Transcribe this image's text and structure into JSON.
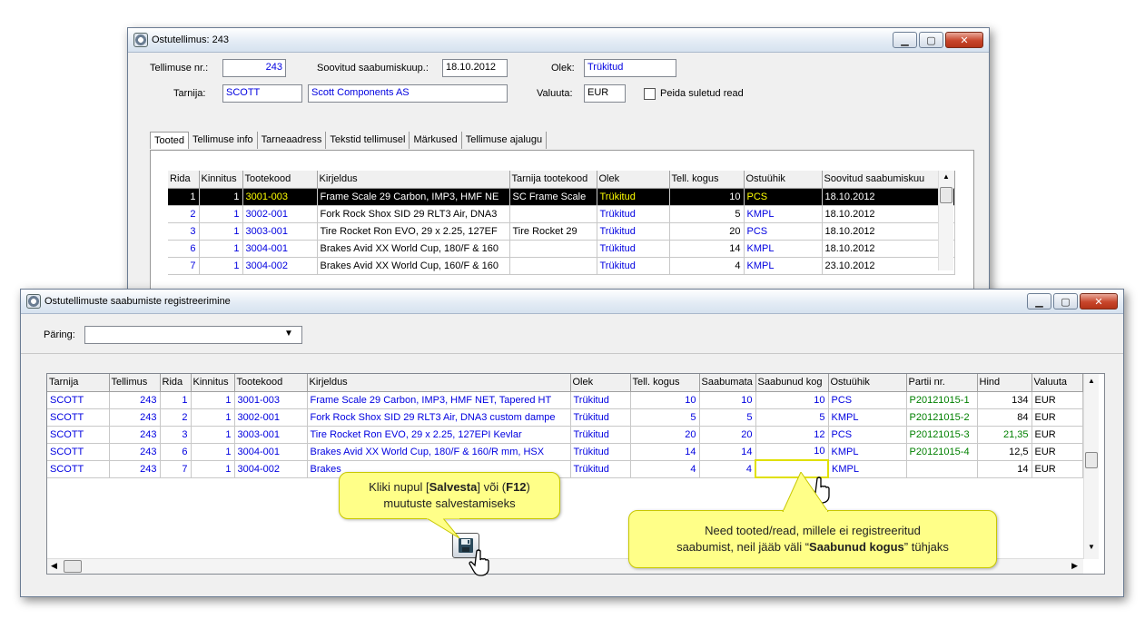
{
  "win1": {
    "title": "Ostutellimus: 243",
    "order_no_label": "Tellimuse nr.:",
    "order_no": "243",
    "arrival_date_label": "Soovitud saabumiskuup.:",
    "arrival_date": "18.10.2012",
    "status_label": "Olek:",
    "status": "Trükitud",
    "supplier_label": "Tarnija:",
    "supplier_code": "SCOTT",
    "supplier_name": "Scott Components AS",
    "currency_label": "Valuuta:",
    "currency": "EUR",
    "hide_closed_label": "Peida suletud read",
    "tabs": [
      "Tooted",
      "Tellimuse info",
      "Tarneaadress",
      "Tekstid tellimusel",
      "Märkused",
      "Tellimuse ajalugu"
    ],
    "columns": [
      "Rida",
      "Kinnitus",
      "Tootekood",
      "Kirjeldus",
      "Tarnija tootekood",
      "Olek",
      "Tell. kogus",
      "Ostuühik",
      "Soovitud saabumiskuu"
    ],
    "rows": [
      {
        "rida": "1",
        "kinnitus": "1",
        "kood": "3001-003",
        "kirjeldus": "Frame Scale 29 Carbon, IMP3, HMF NE",
        "tarnija_kood": "SC Frame Scale",
        "olek": "Trükitud",
        "kogus": "10",
        "uhik": "PCS",
        "kuup": "18.10.2012"
      },
      {
        "rida": "2",
        "kinnitus": "1",
        "kood": "3002-001",
        "kirjeldus": "Fork Rock Shox SID 29 RLT3 Air, DNA3",
        "tarnija_kood": "",
        "olek": "Trükitud",
        "kogus": "5",
        "uhik": "KMPL",
        "kuup": "18.10.2012"
      },
      {
        "rida": "3",
        "kinnitus": "1",
        "kood": "3003-001",
        "kirjeldus": "Tire Rocket Ron EVO, 29 x 2.25, 127EF",
        "tarnija_kood": "Tire Rocket 29",
        "olek": "Trükitud",
        "kogus": "20",
        "uhik": "PCS",
        "kuup": "18.10.2012"
      },
      {
        "rida": "6",
        "kinnitus": "1",
        "kood": "3004-001",
        "kirjeldus": "Brakes Avid XX World Cup, 180/F & 160",
        "tarnija_kood": "",
        "olek": "Trükitud",
        "kogus": "14",
        "uhik": "KMPL",
        "kuup": "18.10.2012"
      },
      {
        "rida": "7",
        "kinnitus": "1",
        "kood": "3004-002",
        "kirjeldus": "Brakes Avid XX World Cup, 160/F & 160",
        "tarnija_kood": "",
        "olek": "Trükitud",
        "kogus": "4",
        "uhik": "KMPL",
        "kuup": "23.10.2012"
      }
    ]
  },
  "win2": {
    "title": "Ostutellimuste saabumiste registreerimine",
    "query_label": "Päring:",
    "query_value": "",
    "columns": [
      "Tarnija",
      "Tellimus",
      "Rida",
      "Kinnitus",
      "Tootekood",
      "Kirjeldus",
      "Olek",
      "Tell. kogus",
      "Saabumata",
      "Saabunud kog",
      "Ostuühik",
      "Partii nr.",
      "Hind",
      "Valuuta"
    ],
    "rows": [
      {
        "tarnija": "SCOTT",
        "tellimus": "243",
        "rida": "1",
        "kinnitus": "1",
        "kood": "3001-003",
        "kirjeldus": "Frame Scale 29 Carbon, IMP3, HMF NET, Tapered HT",
        "olek": "Trükitud",
        "kogus": "10",
        "saabumata": "10",
        "saabunud": "10",
        "uhik": "PCS",
        "partii": "P20121015-1",
        "hind": "134",
        "valuuta": "EUR"
      },
      {
        "tarnija": "SCOTT",
        "tellimus": "243",
        "rida": "2",
        "kinnitus": "1",
        "kood": "3002-001",
        "kirjeldus": "Fork Rock Shox SID 29 RLT3 Air, DNA3 custom dampe",
        "olek": "Trükitud",
        "kogus": "5",
        "saabumata": "5",
        "saabunud": "5",
        "uhik": "KMPL",
        "partii": "P20121015-2",
        "hind": "84",
        "valuuta": "EUR"
      },
      {
        "tarnija": "SCOTT",
        "tellimus": "243",
        "rida": "3",
        "kinnitus": "1",
        "kood": "3003-001",
        "kirjeldus": "Tire Rocket Ron EVO, 29 x 2.25, 127EPI Kevlar",
        "olek": "Trükitud",
        "kogus": "20",
        "saabumata": "20",
        "saabunud": "12",
        "uhik": "PCS",
        "partii": "P20121015-3",
        "hind": "21,35",
        "valuuta": "EUR"
      },
      {
        "tarnija": "SCOTT",
        "tellimus": "243",
        "rida": "6",
        "kinnitus": "1",
        "kood": "3004-001",
        "kirjeldus": "Brakes Avid XX World Cup, 180/F & 160/R mm, HSX",
        "olek": "Trükitud",
        "kogus": "14",
        "saabumata": "14",
        "saabunud": "10",
        "uhik": "KMPL",
        "partii": "P20121015-4",
        "hind": "12,5",
        "valuuta": "EUR"
      },
      {
        "tarnija": "SCOTT",
        "tellimus": "243",
        "rida": "7",
        "kinnitus": "1",
        "kood": "3004-002",
        "kirjeldus": "Brakes",
        "olek": "Trükitud",
        "kogus": "4",
        "saabumata": "4",
        "saabunud": "",
        "uhik": "KMPL",
        "partii": "",
        "hind": "14",
        "valuuta": "EUR"
      }
    ]
  },
  "callout_save": {
    "line1_pre": "Kliki nupul [",
    "line1_b1": "Salvesta",
    "line1_mid": "] või (",
    "line1_b2": "F12",
    "line1_post": ")",
    "line2": "muutuste salvestamiseks"
  },
  "callout_note": {
    "line1": "Need tooted/read, millele ei registreeritud",
    "line2_pre": "saabumist, neil jääb väli “",
    "line2_b": "Saabunud kogus",
    "line2_post": "” tühjaks"
  },
  "colors": {
    "accent_blue": "#0000e0",
    "green": "#008000",
    "callout": "#ffff88",
    "selected_row": "#000000",
    "selected_text": "#ffff00"
  }
}
